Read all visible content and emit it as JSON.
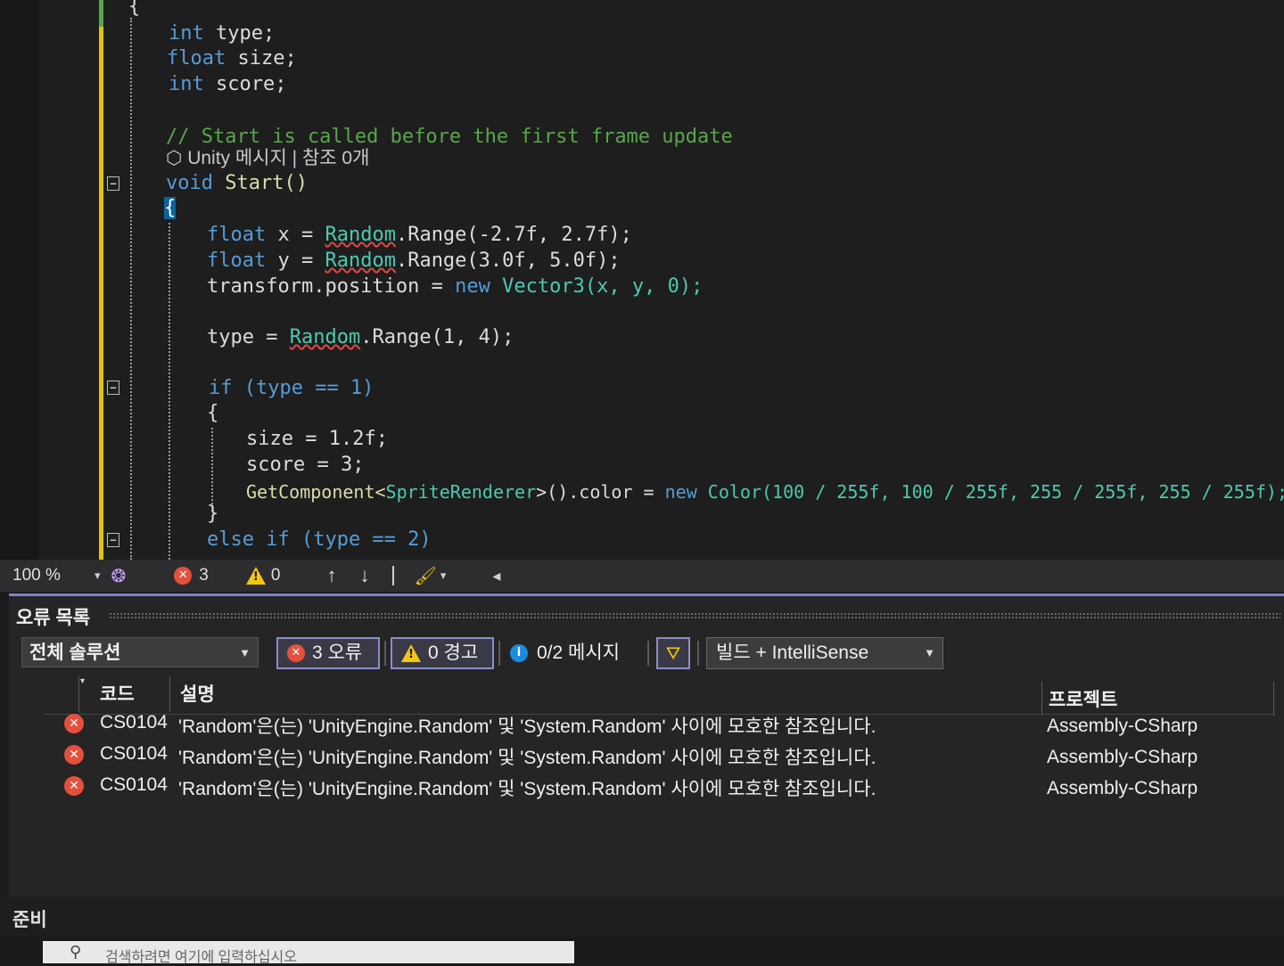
{
  "editor": {
    "lines": {
      "l1": [
        "int",
        "type;"
      ],
      "l2": [
        "float",
        "size;"
      ],
      "l3": [
        "int",
        "score;"
      ],
      "comment": "// Start is called before the first frame update",
      "codelens_icon": "unity-icon",
      "codelens": "Unity 메시지 | 참조 0개",
      "start_kw": "void",
      "start_name": "Start()",
      "open_brace": "{",
      "float_x": {
        "kw": "float",
        "rest1": " x = ",
        "cls": "Random",
        "rest2": ".Range(-2.7f, 2.7f);"
      },
      "float_y": {
        "kw": "float",
        "rest1": " y = ",
        "cls": "Random",
        "rest2": ".Range(3.0f, 5.0f);"
      },
      "transform": {
        "a": "transform.position = ",
        "kw": "new",
        "b": " Vector3(x, y, 0);"
      },
      "type_assign": {
        "a": "type = ",
        "cls": "Random",
        "b": ".Range(1, 4);"
      },
      "if_line": "if (type == 1)",
      "if_brace": "{",
      "size_line": "size = 1.2f;",
      "score_line": "score = 3;",
      "getcomp": {
        "a": "GetComponent<",
        "t": "SpriteRenderer",
        "b": ">().color = ",
        "kw": "new",
        "c": " Color(100 / 255f, 100 / 255f, 255 / 255f, 255 / 255f);"
      },
      "close_brace": "}",
      "else_line": "else if (type == 2)"
    }
  },
  "editor_status": {
    "zoom": "100 %",
    "zoom_caret": "▾",
    "error_count": "3",
    "warning_count": "0",
    "up_arrow": "↑",
    "down_arrow": "↓",
    "left_triangle": "◂"
  },
  "error_list": {
    "title": "오류 목록",
    "scope": "전체 솔루션",
    "errors_btn": "3 오류",
    "warnings_btn": "0 경고",
    "messages": "0/2 메시지",
    "build_filter": "빌드 + IntelliSense",
    "columns": {
      "code": "코드",
      "description": "설명",
      "project": "프로젝트"
    },
    "rows": [
      {
        "code": "CS0104",
        "description": "'Random'은(는) 'UnityEngine.Random' 및 'System.Random' 사이에 모호한 참조입니다.",
        "project": "Assembly-CSharp"
      },
      {
        "code": "CS0104",
        "description": "'Random'은(는) 'UnityEngine.Random' 및 'System.Random' 사이에 모호한 참조입니다.",
        "project": "Assembly-CSharp"
      },
      {
        "code": "CS0104",
        "description": "'Random'은(는) 'UnityEngine.Random' 및 'System.Random' 사이에 모호한 참조입니다.",
        "project": "Assembly-CSharp"
      }
    ]
  },
  "status_bar": {
    "ready": "준비"
  },
  "taskbar": {
    "search_placeholder": "검색하려면 여기에 입력하십시오"
  },
  "colors": {
    "error": "#e5503c",
    "warning": "#f2c611",
    "info": "#1b8be0",
    "accent": "#7e83c8"
  }
}
